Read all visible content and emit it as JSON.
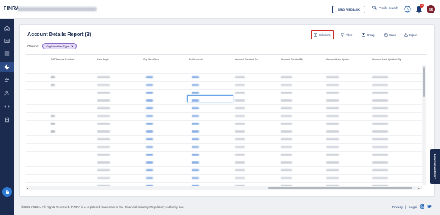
{
  "header": {
    "logo": "FINRA",
    "feedback_label": "SEND FEEDBACK",
    "search_label": "Profile Search",
    "notification_count": "15",
    "avatar_initials": "SR"
  },
  "sidebar": {
    "items": [
      {
        "icon": "home-icon"
      },
      {
        "icon": "profile-card-icon"
      },
      {
        "icon": "list-icon"
      },
      {
        "icon": "pie-chart-icon",
        "active": true
      },
      {
        "icon": "users-icon"
      },
      {
        "icon": "user-settings-icon"
      },
      {
        "icon": "code-icon"
      },
      {
        "icon": "book-icon"
      }
    ],
    "bottom_icon": "briefcase-icon"
  },
  "report": {
    "title": "Account Details Report (3)",
    "toolbar": {
      "columns": "Columns",
      "filter": "Filter",
      "group": "Group",
      "save": "Save",
      "export": "Export"
    },
    "groups_label": "Groups:",
    "group_chip": "Org Identifier Type",
    "columns": [
      "CAT Access Product..",
      "Last Login",
      "Org Identifiers",
      "Entitlements",
      "Account Created On",
      "Account Created By",
      "Account Last Updat...",
      "Account Last Updated By"
    ]
  },
  "help_tab": "How can we help?",
  "footer": {
    "copyright": "©2022 FINRA. All Rights Reserved. FINRA is a registered trademark of the Financial Industry Regulatory Authority, Inc.",
    "privacy": "Privacy",
    "separator": "|",
    "legal": "Legal"
  }
}
